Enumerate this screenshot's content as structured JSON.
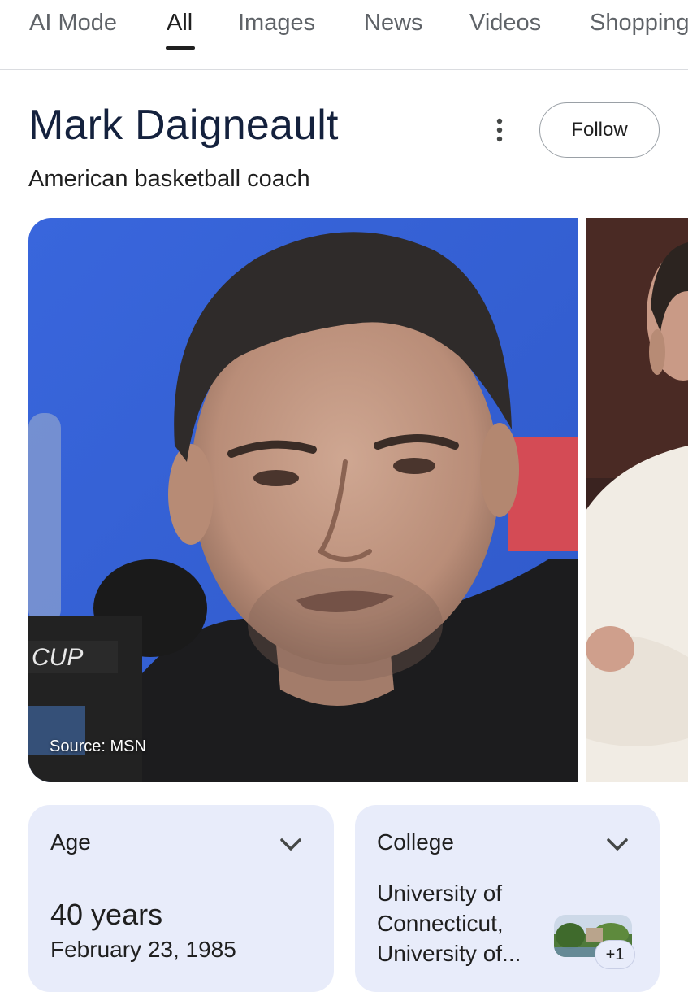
{
  "tabs": [
    {
      "label": "AI Mode",
      "active": false
    },
    {
      "label": "All",
      "active": true
    },
    {
      "label": "Images",
      "active": false
    },
    {
      "label": "News",
      "active": false
    },
    {
      "label": "Videos",
      "active": false
    },
    {
      "label": "Shopping",
      "active": false
    }
  ],
  "entity": {
    "name": "Mark Daigneault",
    "description": "American basketball coach",
    "follow_label": "Follow",
    "more_icon": "more-vert-icon"
  },
  "photos": {
    "source_label": "Source: MSN",
    "mic_flag_text": "CUP"
  },
  "cards": {
    "age": {
      "label": "Age",
      "value": "40 years",
      "detail": "February 23, 1985",
      "icon": "chevron-down-icon"
    },
    "college": {
      "label": "College",
      "lines": [
        "University of",
        "Connecticut,",
        "University of..."
      ],
      "more_count": "+1",
      "icon": "chevron-down-icon"
    }
  },
  "colors": {
    "title": "#14213d",
    "card_bg": "#e8ecfa",
    "photo_bg": "#3c63d6"
  }
}
